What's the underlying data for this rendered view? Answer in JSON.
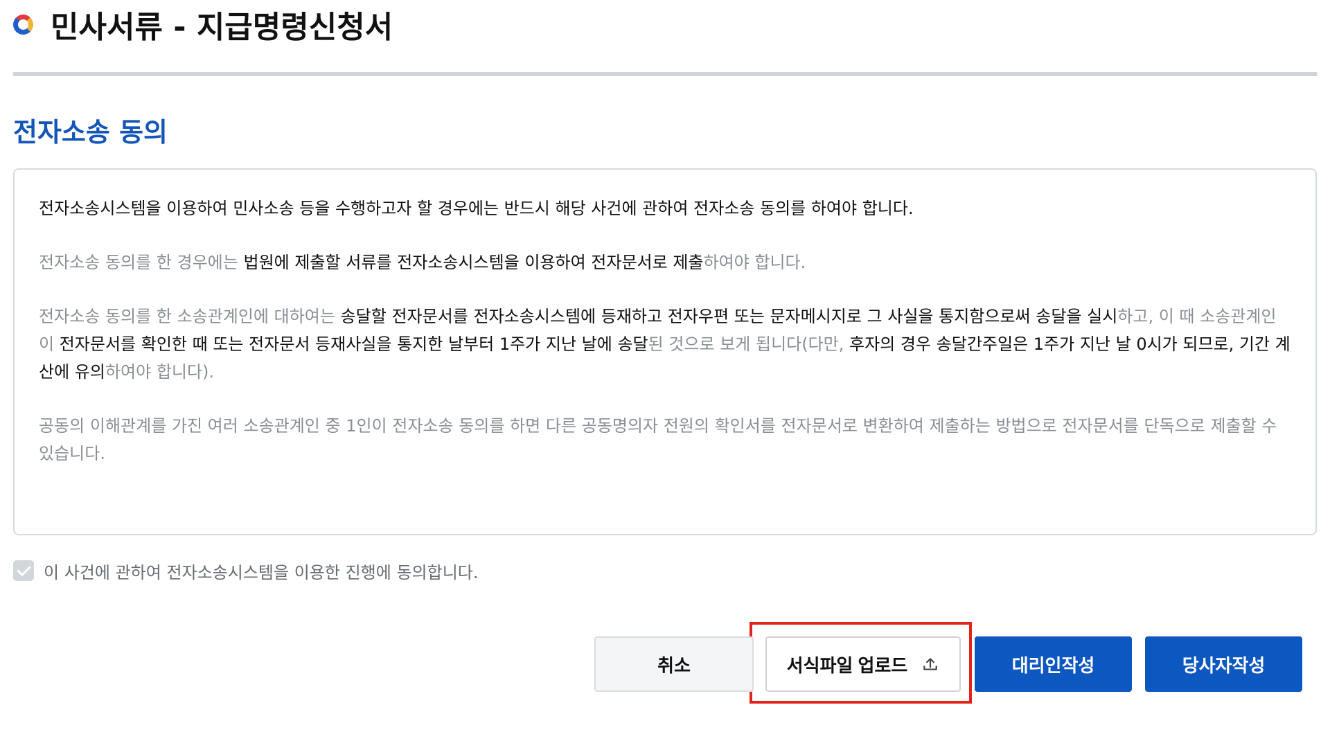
{
  "header": {
    "title": "민사서류 - 지급명령신청서",
    "logo_icon": "ring-logo-icon"
  },
  "section": {
    "heading": "전자소송 동의"
  },
  "notice": {
    "p1": "전자소송시스템을 이용하여 민사소송 등을 수행하고자 할 경우에는 반드시 해당 사건에 관하여 전자소송 동의를 하여야 합니다.",
    "p2_a": "전자소송 동의를 한 경우에는 ",
    "p2_b": "법원에 제출할 서류를 전자소송시스템을 이용하여 전자문서로 제출",
    "p2_c": "하여야 합니다.",
    "p3_a": "전자소송 동의를 한 소송관계인에 대하여는 ",
    "p3_b": "송달할 전자문서를 전자소송시스템에 등재하고 전자우편 또는 문자메시지로 그 사실을 통지함으로써 송달을 실시",
    "p3_c": "하고, 이 때 소송관계인이 ",
    "p3_d": "전자문서를 확인한 때 또는 전자문서 등재사실을 통지한 날부터 1주가 지난 날에 송달",
    "p3_e": "된 것으로 보게 됩니다(다만, ",
    "p3_f": "후자의 경우 송달간주일은 1주가 지난 날 0시가 되므로, 기간 계산에 유의",
    "p3_g": "하여야 합니다).",
    "p4": "공동의 이해관계를 가진 여러 소송관계인 중 1인이 전자소송 동의를 하면 다른 공동명의자 전원의 확인서를 전자문서로 변환하여 제출하는 방법으로 전자문서를 단독으로 제출할 수 있습니다."
  },
  "agreement": {
    "label": "이 사건에 관하여 전자소송시스템을 이용한 진행에 동의합니다.",
    "checked": true
  },
  "buttons": {
    "cancel": "취소",
    "upload": "서식파일 업로드",
    "upload_icon": "upload-icon",
    "agent": "대리인작성",
    "party": "당사자작성"
  },
  "colors": {
    "primary": "#0c57c0",
    "heading_blue": "#1456b8",
    "highlight_red": "#e2231a",
    "muted_text": "#8a8f96"
  }
}
